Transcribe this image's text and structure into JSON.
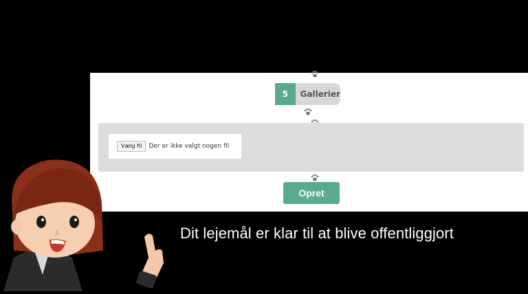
{
  "flow": {
    "step": {
      "number": "5",
      "label": "Gallerier"
    },
    "file_input": {
      "button_label": "Vælg fil",
      "status_text": "Der er ikke valgt nogen fil"
    },
    "create_button": "Opret"
  },
  "subtitle": "Dit lejemål er klar til at blive offentliggjort",
  "colors": {
    "accent": "#5aaa8e",
    "panel": "#dcdcdc",
    "step_bg": "#d8d8d8",
    "background": "#000000"
  },
  "icons": [
    "paw-icon",
    "presenter-avatar"
  ]
}
